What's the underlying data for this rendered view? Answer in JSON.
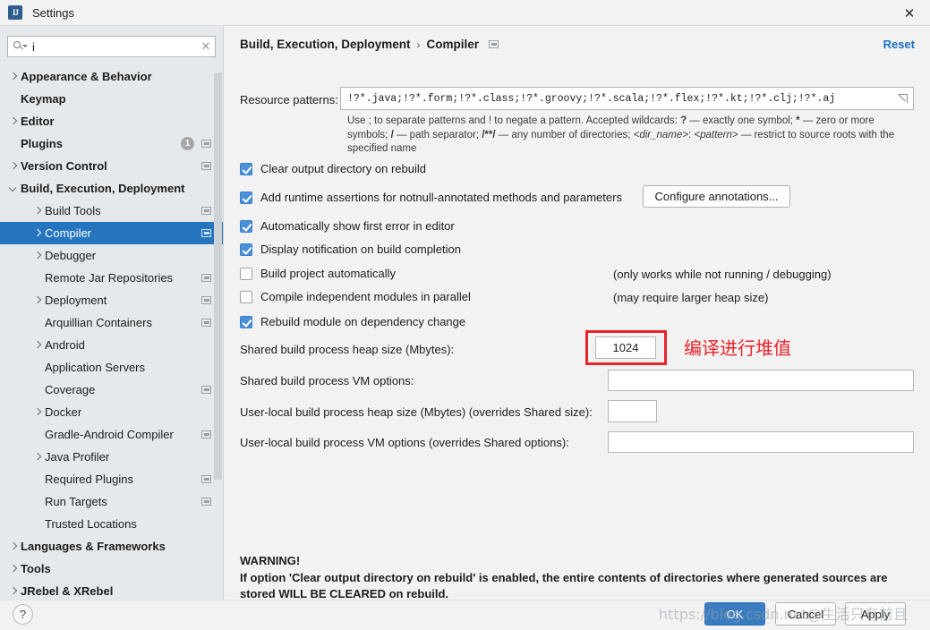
{
  "window": {
    "title": "Settings",
    "app_icon": "intellij-idea-icon",
    "close_label": "✕"
  },
  "sidebar": {
    "search": {
      "value": "i",
      "placeholder": "",
      "clear_label": "✕"
    },
    "items": [
      {
        "label": "Appearance & Behavior",
        "arrow": "right",
        "bold": true,
        "indent": 0,
        "badge": null,
        "proj": false,
        "selected": false
      },
      {
        "label": "Keymap",
        "arrow": "none",
        "bold": true,
        "indent": 0,
        "badge": null,
        "proj": false,
        "selected": false
      },
      {
        "label": "Editor",
        "arrow": "right",
        "bold": true,
        "indent": 0,
        "badge": null,
        "proj": false,
        "selected": false
      },
      {
        "label": "Plugins",
        "arrow": "none",
        "bold": true,
        "indent": 0,
        "badge": "1",
        "proj": true,
        "selected": false
      },
      {
        "label": "Version Control",
        "arrow": "right",
        "bold": true,
        "indent": 0,
        "badge": null,
        "proj": true,
        "selected": false
      },
      {
        "label": "Build, Execution, Deployment",
        "arrow": "down",
        "bold": true,
        "indent": 0,
        "badge": null,
        "proj": false,
        "selected": false
      },
      {
        "label": "Build Tools",
        "arrow": "right",
        "bold": false,
        "indent": 1,
        "badge": null,
        "proj": true,
        "selected": false
      },
      {
        "label": "Compiler",
        "arrow": "right",
        "bold": false,
        "indent": 1,
        "badge": null,
        "proj": true,
        "selected": true
      },
      {
        "label": "Debugger",
        "arrow": "right",
        "bold": false,
        "indent": 1,
        "badge": null,
        "proj": false,
        "selected": false
      },
      {
        "label": "Remote Jar Repositories",
        "arrow": "none",
        "bold": false,
        "indent": 1,
        "badge": null,
        "proj": true,
        "selected": false
      },
      {
        "label": "Deployment",
        "arrow": "right",
        "bold": false,
        "indent": 1,
        "badge": null,
        "proj": true,
        "selected": false
      },
      {
        "label": "Arquillian Containers",
        "arrow": "none",
        "bold": false,
        "indent": 1,
        "badge": null,
        "proj": true,
        "selected": false
      },
      {
        "label": "Android",
        "arrow": "right",
        "bold": false,
        "indent": 1,
        "badge": null,
        "proj": false,
        "selected": false
      },
      {
        "label": "Application Servers",
        "arrow": "none",
        "bold": false,
        "indent": 1,
        "badge": null,
        "proj": false,
        "selected": false
      },
      {
        "label": "Coverage",
        "arrow": "none",
        "bold": false,
        "indent": 1,
        "badge": null,
        "proj": true,
        "selected": false
      },
      {
        "label": "Docker",
        "arrow": "right",
        "bold": false,
        "indent": 1,
        "badge": null,
        "proj": false,
        "selected": false
      },
      {
        "label": "Gradle-Android Compiler",
        "arrow": "none",
        "bold": false,
        "indent": 1,
        "badge": null,
        "proj": true,
        "selected": false
      },
      {
        "label": "Java Profiler",
        "arrow": "right",
        "bold": false,
        "indent": 1,
        "badge": null,
        "proj": false,
        "selected": false
      },
      {
        "label": "Required Plugins",
        "arrow": "none",
        "bold": false,
        "indent": 1,
        "badge": null,
        "proj": true,
        "selected": false
      },
      {
        "label": "Run Targets",
        "arrow": "none",
        "bold": false,
        "indent": 1,
        "badge": null,
        "proj": true,
        "selected": false
      },
      {
        "label": "Trusted Locations",
        "arrow": "none",
        "bold": false,
        "indent": 1,
        "badge": null,
        "proj": false,
        "selected": false
      },
      {
        "label": "Languages & Frameworks",
        "arrow": "right",
        "bold": true,
        "indent": 0,
        "badge": null,
        "proj": false,
        "selected": false
      },
      {
        "label": "Tools",
        "arrow": "right",
        "bold": true,
        "indent": 0,
        "badge": null,
        "proj": false,
        "selected": false
      },
      {
        "label": "JRebel & XRebel",
        "arrow": "right",
        "bold": true,
        "indent": 0,
        "badge": null,
        "proj": false,
        "selected": false
      }
    ]
  },
  "main": {
    "breadcrumb": {
      "root": "Build, Execution, Deployment",
      "separator": "›",
      "leaf": "Compiler"
    },
    "reset_label": "Reset",
    "resource_patterns": {
      "label": "Resource patterns:",
      "value": "!?*.java;!?*.form;!?*.class;!?*.groovy;!?*.scala;!?*.flex;!?*.kt;!?*.clj;!?*.aj",
      "expand_icon": "expand-editor-icon"
    },
    "help_text_part1": "Use ; to separate patterns and ! to negate a pattern. Accepted wildcards: ",
    "help_text_q": "?",
    "help_text_part2": " — exactly one symbol; ",
    "help_text_star": "*",
    "help_text_part3": " — zero or more symbols; ",
    "help_text_slash": "/",
    "help_text_part4": " — path separator; ",
    "help_text_dbl": "/**/",
    "help_text_part5": " — any number of directories;  ",
    "help_text_dir": "<dir_name>",
    "help_text_colon": ": ",
    "help_text_pat": "<pattern>",
    "help_text_part6": " — restrict to source roots with the specified name",
    "checkboxes": [
      {
        "label": "Clear output directory on rebuild",
        "checked": true,
        "hint": ""
      },
      {
        "label": "Add runtime assertions for notnull-annotated methods and parameters",
        "checked": true,
        "hint": ""
      },
      {
        "label": "Automatically show first error in editor",
        "checked": true,
        "hint": ""
      },
      {
        "label": "Display notification on build completion",
        "checked": true,
        "hint": ""
      },
      {
        "label": "Build project automatically",
        "checked": false,
        "hint": "(only works while not running / debugging)"
      },
      {
        "label": "Compile independent modules in parallel",
        "checked": false,
        "hint": "(may require larger heap size)"
      },
      {
        "label": "Rebuild module on dependency change",
        "checked": true,
        "hint": ""
      }
    ],
    "configure_annotations_label": "Configure annotations...",
    "fields": {
      "shared_heap_label": "Shared build process heap size (Mbytes):",
      "shared_heap_value": "1024",
      "shared_vm_label": "Shared build process VM options:",
      "shared_vm_value": "",
      "user_heap_label": "User-local build process heap size (Mbytes) (overrides Shared size):",
      "user_heap_value": "",
      "user_vm_label": "User-local build process VM options (overrides Shared options):",
      "user_vm_value": ""
    },
    "annotation_cn": "编译进行堆值",
    "annotation_color": "#e8232a",
    "warning_title": "WARNING!",
    "warning_body": "If option 'Clear output directory on rebuild' is enabled, the entire contents of directories where generated sources are stored WILL BE CLEARED on rebuild."
  },
  "bottom": {
    "help_label": "?",
    "ok_label": "OK",
    "cancel_label": "Cancel",
    "apply_label": "Apply",
    "watermark": "https://blog.csdn.net@生活只有前且"
  },
  "colors": {
    "accent": "#2675bf",
    "link": "#1a6fc4",
    "annotation_red": "#e8232a",
    "sidebar_bg": "#e5e9ec",
    "panel_bg": "#f2f2f2"
  }
}
